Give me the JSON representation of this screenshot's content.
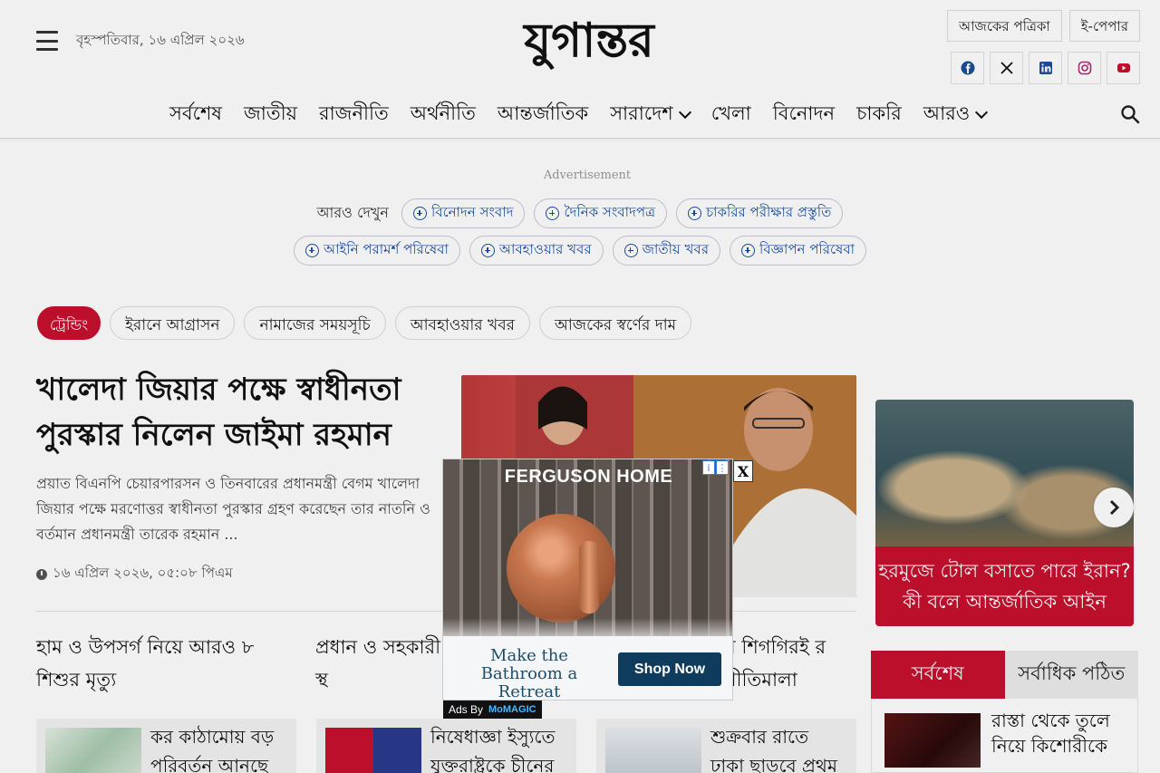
{
  "header": {
    "date": "বৃহস্পতিবার, ১৬ এপ্রিল ২০২৬",
    "logo_text": "যুগান্তর",
    "top_links": [
      "আজকের পত্রিকা",
      "ই-পেপার"
    ],
    "social_icons": [
      "facebook-icon",
      "x-icon",
      "linkedin-icon",
      "instagram-icon",
      "youtube-icon"
    ]
  },
  "nav": {
    "items": [
      "সর্বশেষ",
      "জাতীয়",
      "রাজনীতি",
      "অর্থনীতি",
      "আন্তর্জাতিক",
      "সারাদেশ",
      "খেলা",
      "বিনোদন",
      "চাকরি",
      "আরও"
    ]
  },
  "ads": {
    "label": "Advertisement"
  },
  "see_more": {
    "title": "আরও দেখুন",
    "row1": [
      "বিনোদন সংবাদ",
      "দৈনিক সংবাদপত্র",
      "চাকরির পরীক্ষার প্রস্তুতি"
    ],
    "row2": [
      "আইনি পরামর্শ পরিষেবা",
      "আবহাওয়ার খবর",
      "জাতীয় খবর",
      "বিজ্ঞাপন পরিষেবা"
    ]
  },
  "trending": {
    "label": "ট্রেন্ডিং",
    "items": [
      "ইরানে আগ্রাসন",
      "নামাজের সময়সূচি",
      "আবহাওয়ার খবর",
      "আজকের স্বর্ণের দাম"
    ]
  },
  "lead": {
    "title": "খালেদা জিয়ার পক্ষে স্বাধীনতা পুরস্কার নিলেন জাইমা রহমান",
    "summary": "প্রয়াত বিএনপি চেয়ারপারসন ও তিনবারের প্রধানমন্ত্রী বেগম খালেদা জিয়ার পক্ষে মরণোত্তর স্বাধীনতা পুরস্কার গ্রহণ করেছেন তার নাতনি ও বর্তমান প্রধানমন্ত্রী তারেক রহমান ...",
    "time": "১৬ এপ্রিল ২০২৬, ০৫:০৮ পিএম"
  },
  "sub_headlines": [
    "হাম ও উপসর্গ নিয়ে আরও ৮ শিশুর মৃত্যু",
    "প্রধান ও সহকারী নিয়োগ পরীক্ষা স্থ",
    "ম শিগগিরই র নীতিমালা"
  ],
  "cards": [
    "কর কাঠামোয় বড় পরিবর্তন আনছে",
    "নিষেধাজ্ঞা ইস্যুতে যুক্তরাষ্ট্রকে চীনের",
    "শুক্রবার রাতে ঢাকা ছাড়বে প্রথম"
  ],
  "side_slider": {
    "caption": "হরমুজে টোল বসাতে পারে ইরান? কী বলে আন্তর্জাতিক আইন"
  },
  "side_tabs": {
    "tabs": [
      "সর্বশেষ",
      "সর্বাধিক পঠিত"
    ],
    "first_item": "রাস্তা থেকে তুলে নিয়ে কিশোরীকে"
  },
  "popup_ad": {
    "brand": "FERGUSON HOME",
    "tagline": "Make the Bathroom a Retreat",
    "cta": "Shop Now",
    "close": "X",
    "ads_by": "Ads By",
    "network": "MoMAGIC"
  },
  "colors": {
    "brand_red": "#c8102e",
    "link_blue": "#1a4fa8",
    "ad_navy": "#0f3b5c"
  }
}
